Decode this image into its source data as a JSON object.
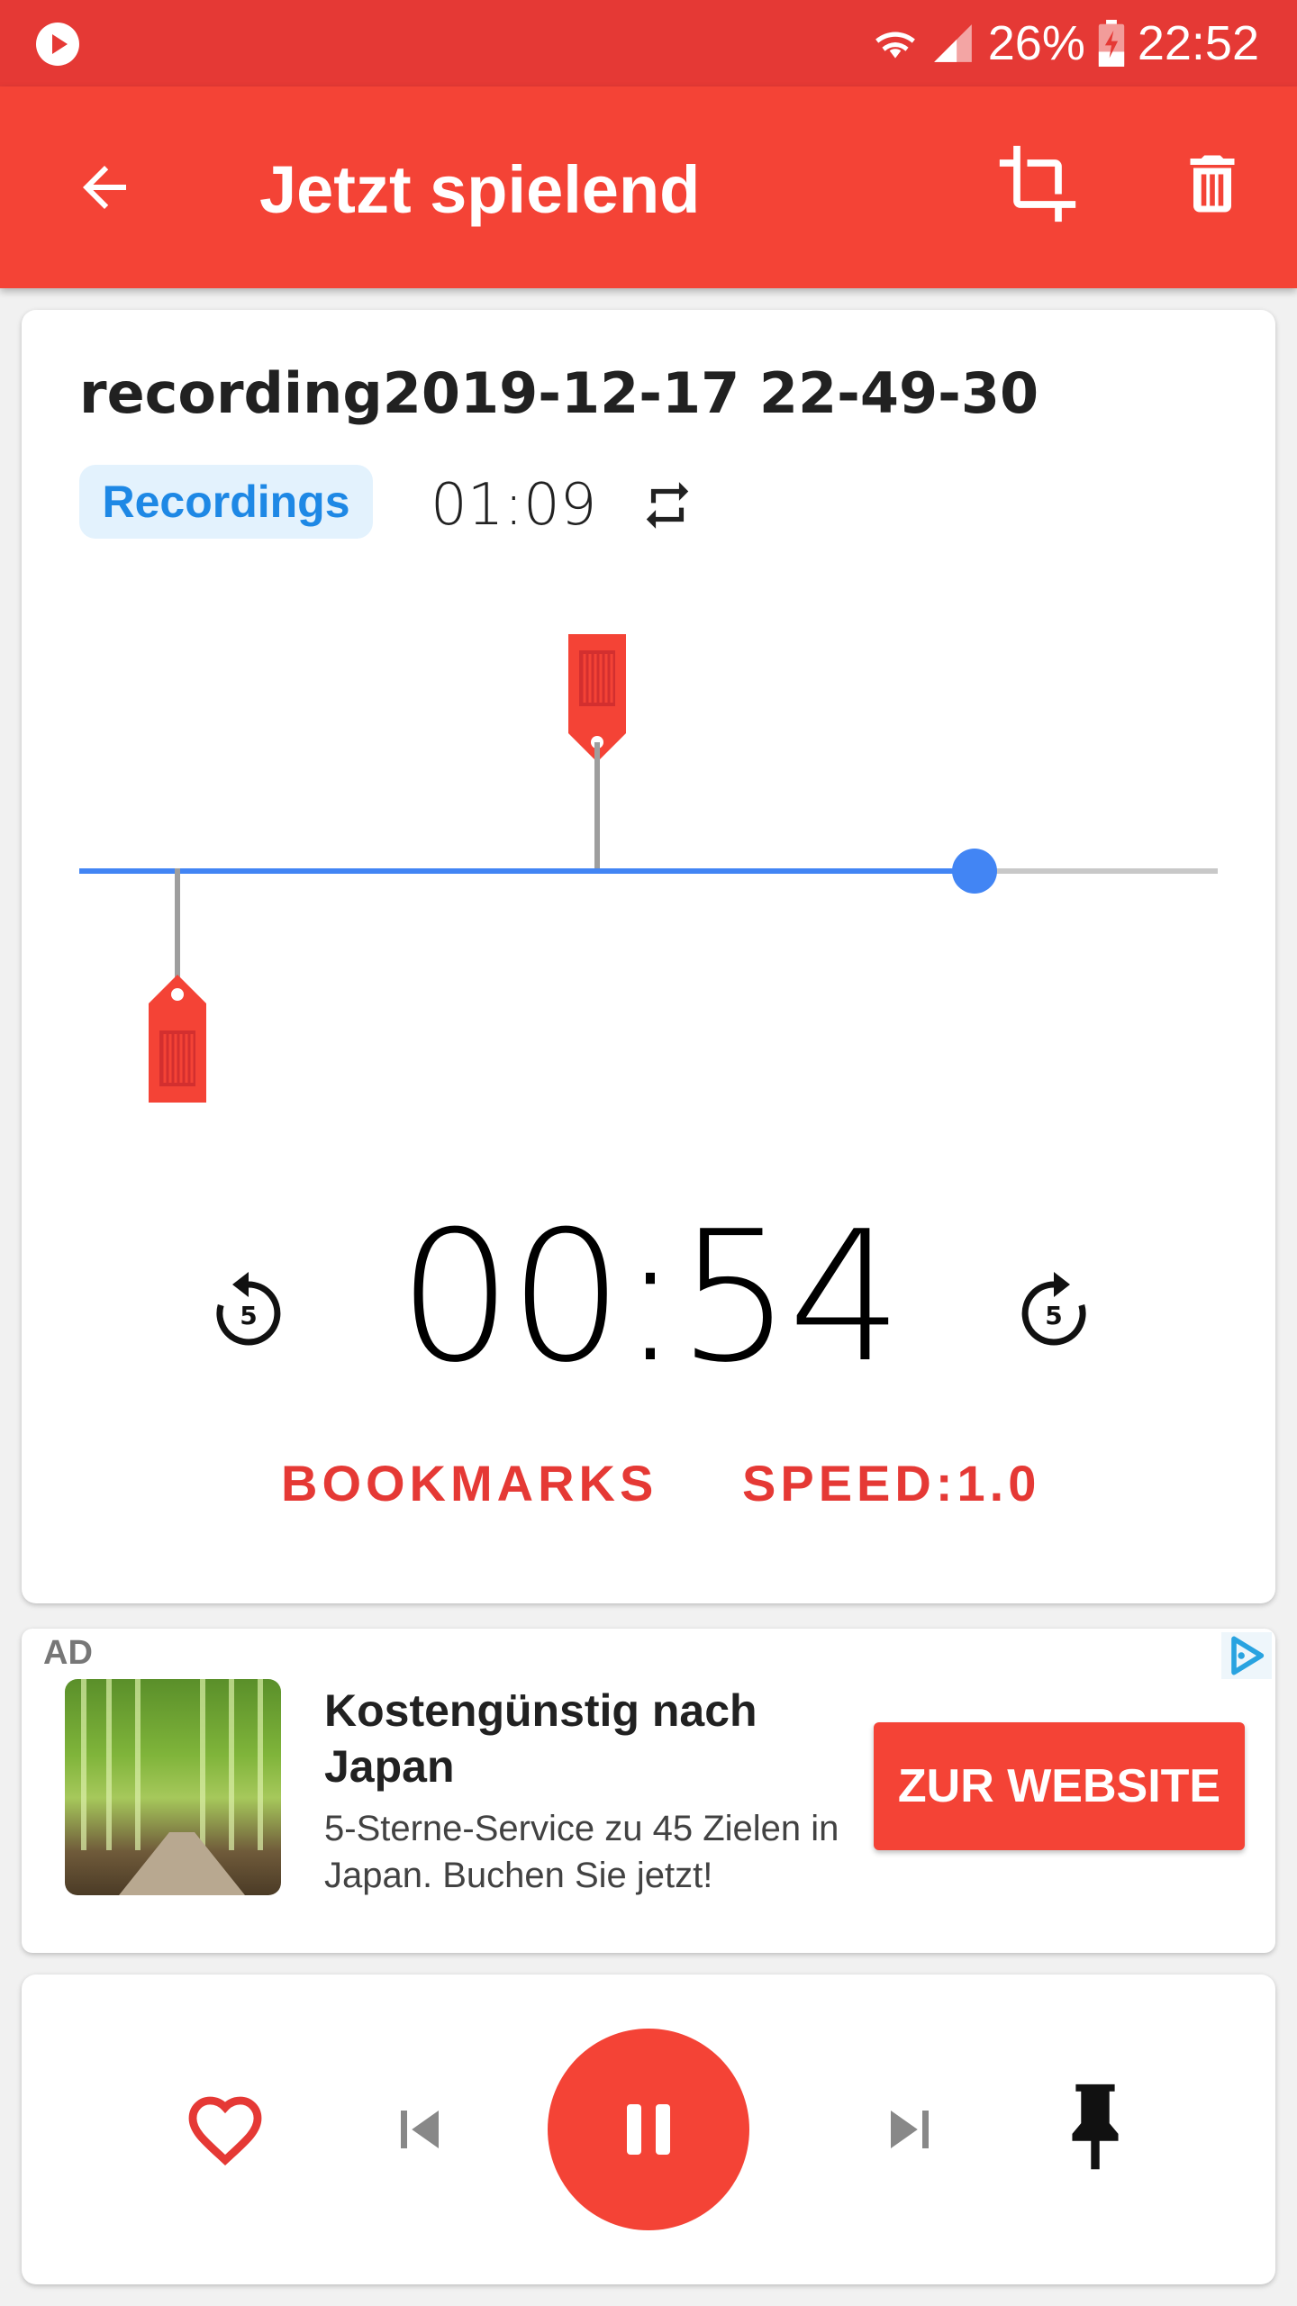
{
  "status_bar": {
    "battery": "26%",
    "time": "22:52"
  },
  "app_bar": {
    "title": "Jetzt spielend",
    "back_icon": "arrow-back-icon",
    "crop_icon": "crop-icon",
    "delete_icon": "trash-icon"
  },
  "recording": {
    "name": "recording2019-12-17 22-49-30",
    "folder": "Recordings",
    "duration": "01:09",
    "current_time": "00:54",
    "progress": 0.786,
    "bookmarks": [
      0.086,
      0.455
    ]
  },
  "player": {
    "rewind_seconds": "5",
    "forward_seconds": "5",
    "bookmarks_label": "BOOKMARKS",
    "speed_label": "SPEED:1.0"
  },
  "ad": {
    "label": "AD",
    "headline": "Kostengünstig nach Japan",
    "body": "5-Sterne-Service zu 45 Zielen in Japan. Buchen Sie jetzt!",
    "cta": "ZUR WEBSITE"
  },
  "controls": {
    "favorite_icon": "heart-outline-icon",
    "previous_icon": "skip-previous-icon",
    "pause_icon": "pause-icon",
    "next_icon": "skip-next-icon",
    "pin_icon": "pin-icon"
  },
  "colors": {
    "status_bar": "#e53935",
    "app_bar": "#f44336",
    "accent_blue": "#4285f4",
    "accent_red": "#e53935"
  }
}
